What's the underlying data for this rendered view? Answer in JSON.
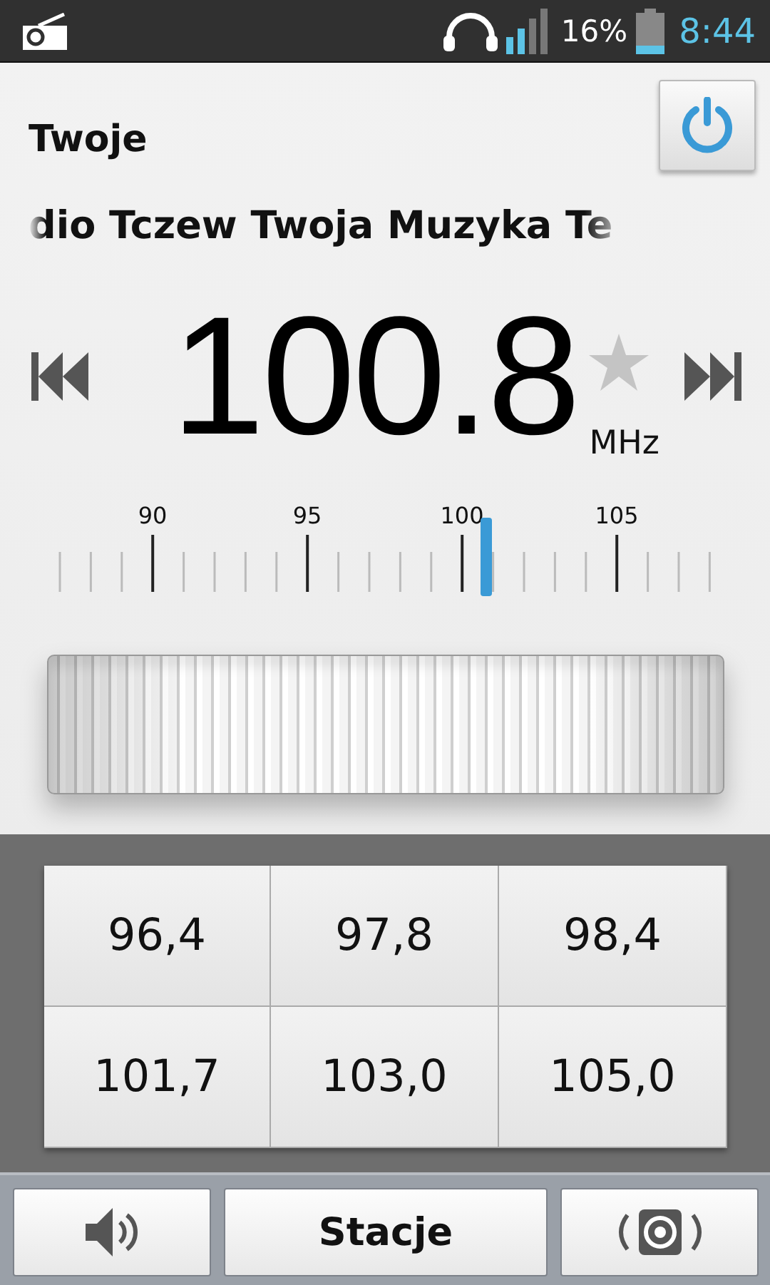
{
  "status_bar": {
    "battery": "16%",
    "time": "8:44"
  },
  "station": {
    "name": "Twoje",
    "radio_text": "dio Tczew Twoja Muzyka Te"
  },
  "tuner": {
    "frequency": "100.8",
    "unit": "MHz",
    "favorite": false,
    "scale_labels": [
      "90",
      "95",
      "100",
      "105"
    ]
  },
  "presets": [
    {
      "label": "96,4"
    },
    {
      "label": "97,8"
    },
    {
      "label": "98,4"
    },
    {
      "label": "101,7"
    },
    {
      "label": "103,0"
    },
    {
      "label": "105,0"
    }
  ],
  "bottom_bar": {
    "stations_label": "Stacje"
  }
}
